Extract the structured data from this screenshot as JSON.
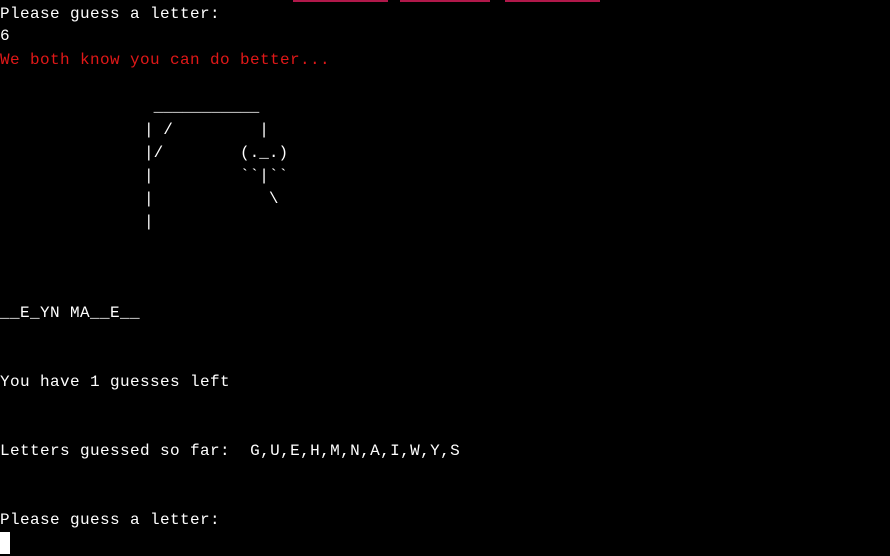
{
  "terminal": {
    "prompt_previous": "Please guess a letter:",
    "previous_input": "6",
    "error_message": "We both know you can do better...",
    "hangman_art": "                ___________\n               | /         |\n               |/        (._.)\n               |         ``|``\n               |            \\\n               |",
    "word_progress": "__E_YN MA__E__",
    "guesses_left_message": "You have 1 guesses left",
    "letters_guessed_label": "Letters guessed so far:",
    "letters_guessed": "G,U,E,H,M,N,A,I,W,Y,S",
    "prompt_current": "Please guess a letter:"
  },
  "colors": {
    "background": "#000000",
    "text": "#ffffff",
    "error": "#e01818",
    "accent_bar": "#b0184a"
  }
}
